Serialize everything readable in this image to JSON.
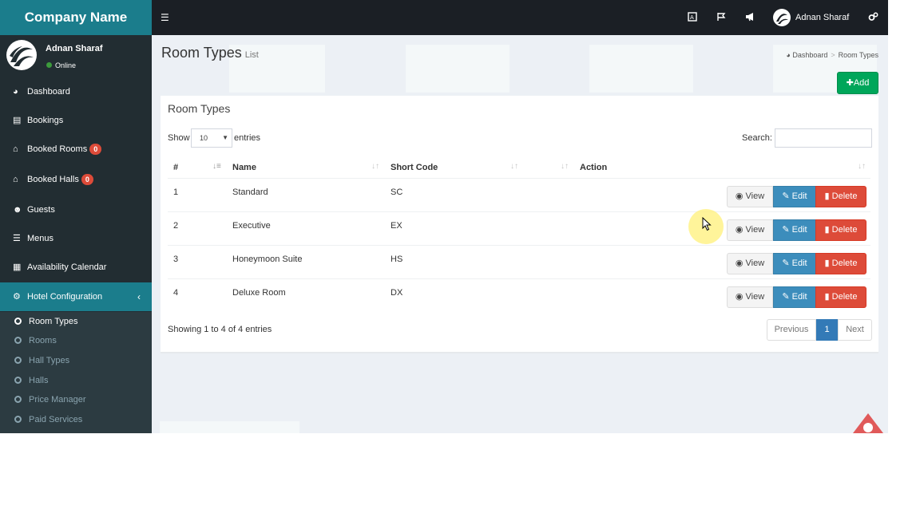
{
  "brand": {
    "name": "Company Name"
  },
  "user": {
    "name": "Adnan Sharaf",
    "status": "Online"
  },
  "sidebar": {
    "items": [
      {
        "label": "Dashboard",
        "icon": "dashboard-icon"
      },
      {
        "label": "Bookings",
        "icon": "bookings-icon"
      },
      {
        "label": "Booked Rooms",
        "icon": "home-icon",
        "badge": "0"
      },
      {
        "label": "Booked Halls",
        "icon": "home-icon",
        "badge": "0"
      },
      {
        "label": "Guests",
        "icon": "users-icon"
      },
      {
        "label": "Menus",
        "icon": "bars-icon"
      },
      {
        "label": "Availability Calendar",
        "icon": "calendar-icon"
      },
      {
        "label": "Hotel Configuration",
        "icon": "cogs-icon"
      }
    ],
    "submenu": [
      {
        "label": "Room Types",
        "active": true
      },
      {
        "label": "Rooms"
      },
      {
        "label": "Hall Types"
      },
      {
        "label": "Halls"
      },
      {
        "label": "Price Manager"
      },
      {
        "label": "Paid Services"
      }
    ]
  },
  "navbar": {
    "user_name": "Adnan Sharaf"
  },
  "page": {
    "title": "Room Types",
    "subtitle": "List",
    "breadcrumb": [
      "Dashboard",
      "Room Types"
    ],
    "add_label": "Add"
  },
  "box": {
    "title": "Room Types",
    "show_label": "Show",
    "page_size": "10",
    "entries_label": "entries",
    "search_label": "Search:"
  },
  "table": {
    "columns": [
      "#",
      "Name",
      "Short Code",
      "Action"
    ],
    "rows": [
      {
        "num": "1",
        "name": "Standard",
        "code": "SC"
      },
      {
        "num": "2",
        "name": "Executive",
        "code": "EX"
      },
      {
        "num": "3",
        "name": "Honeymoon Suite",
        "code": "HS"
      },
      {
        "num": "4",
        "name": "Deluxe Room",
        "code": "DX"
      }
    ],
    "actions": {
      "view": "View",
      "edit": "Edit",
      "delete": "Delete"
    }
  },
  "footer": {
    "info": "Showing 1 to 4 of 4 entries",
    "prev": "Previous",
    "page": "1",
    "next": "Next"
  },
  "colors": {
    "brand": "#1b7d8c",
    "sidebar": "#222d32",
    "navbar": "#1b1f25",
    "add": "#00a65a",
    "edit": "#3c8dbc",
    "delete": "#dd4b39"
  }
}
